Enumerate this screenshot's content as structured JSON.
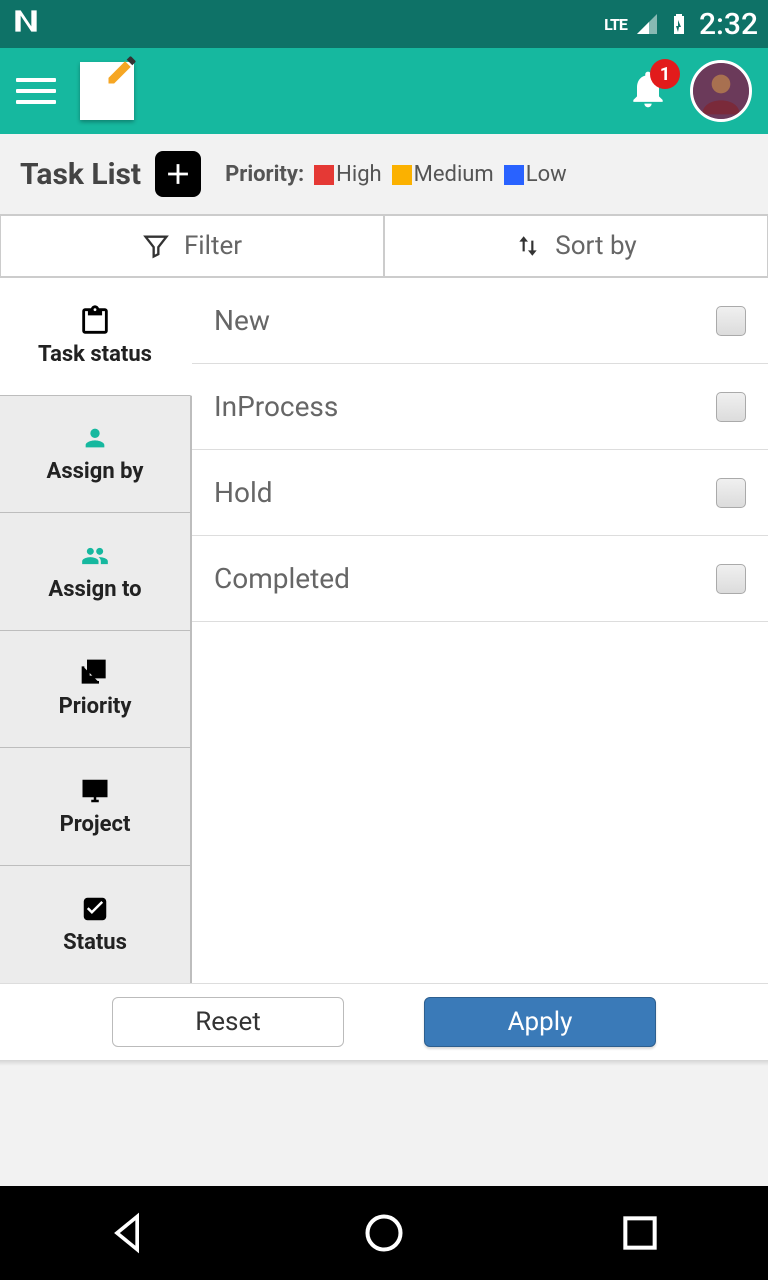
{
  "status": {
    "time": "2:32",
    "network": "LTE"
  },
  "appbar": {
    "notification_count": "1"
  },
  "header": {
    "title": "Task List",
    "priority_label": "Priority:",
    "legend": {
      "high": "High",
      "medium": "Medium",
      "low": "Low"
    }
  },
  "controls": {
    "filter": "Filter",
    "sort": "Sort by"
  },
  "sidebar_tabs": {
    "task_status": "Task status",
    "assign_by": "Assign by",
    "assign_to": "Assign to",
    "priority": "Priority",
    "project": "Project",
    "status": "Status"
  },
  "options": {
    "new": "New",
    "inprocess": "InProcess",
    "hold": "Hold",
    "completed": "Completed"
  },
  "footer": {
    "reset": "Reset",
    "apply": "Apply"
  }
}
